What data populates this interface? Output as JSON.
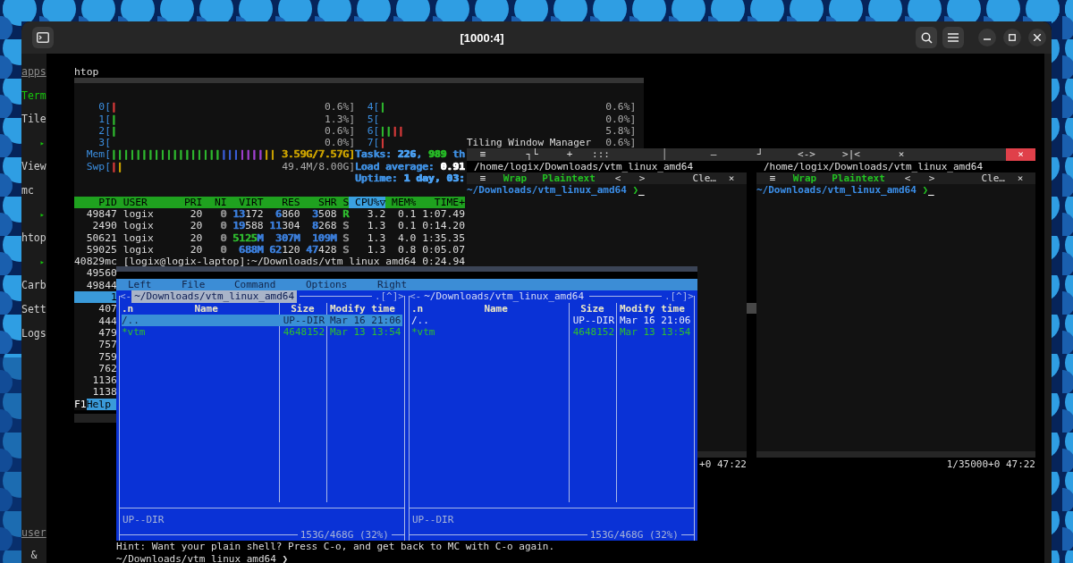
{
  "window": {
    "title": "[1000:4]"
  },
  "sidebar": {
    "items": [
      {
        "label": "apps",
        "kind": "heading",
        "selected": false
      },
      {
        "label": "Term",
        "kind": "app",
        "selected": true
      },
      {
        "label": "Tile",
        "kind": "app",
        "selected": false
      },
      {
        "label": "▸",
        "kind": "arrow"
      },
      {
        "label": "View",
        "kind": "app",
        "selected": false
      },
      {
        "label": "mc",
        "kind": "app",
        "selected": false
      },
      {
        "label": "▸",
        "kind": "arrow"
      },
      {
        "label": "htop",
        "kind": "app",
        "selected": false
      },
      {
        "label": "▸",
        "kind": "arrow"
      },
      {
        "label": "Carb",
        "kind": "app",
        "selected": false
      },
      {
        "label": "Sett",
        "kind": "app",
        "selected": false
      },
      {
        "label": "Logs",
        "kind": "app",
        "selected": false
      }
    ],
    "footer": [
      {
        "label": "user",
        "kind": "heading"
      },
      {
        "label": "&",
        "kind": "app"
      }
    ]
  },
  "htop": {
    "title": "htop",
    "meters_left": [
      {
        "label": "0[",
        "bar": [
          {
            "text": "|",
            "color": "#d33a3a"
          }
        ],
        "reading": "0.6%]"
      },
      {
        "label": "1[",
        "bar": [
          {
            "text": "|",
            "color": "#2fb82f"
          }
        ],
        "reading": "1.3%]"
      },
      {
        "label": "2[",
        "bar": [
          {
            "text": "|",
            "color": "#2fb82f"
          }
        ],
        "reading": "0.6%]"
      },
      {
        "label": "3[",
        "reading": "0.0%]"
      },
      {
        "label": "Mem[",
        "bar": [
          {
            "text": "||||||||||||||||||",
            "color": "#2fb82f"
          },
          {
            "text": "|||",
            "color": "#3b5fd8"
          },
          {
            "text": "||||",
            "color": "#a040d0"
          },
          {
            "text": "||",
            "color": "#c8a000"
          }
        ],
        "reading": {
          "text": "3.59G/7.57G]",
          "color": "#c8a000"
        }
      },
      {
        "label": "Swp[",
        "bar": [
          {
            "text": "|",
            "color": "#d33a3a"
          },
          {
            "text": "|",
            "color": "#c8a000"
          }
        ],
        "reading": "49.4M/8.00G]"
      }
    ],
    "meters_right": [
      {
        "label": "4[",
        "bar": [
          {
            "text": "|",
            "color": "#2fb82f"
          }
        ],
        "reading": "0.6%]"
      },
      {
        "label": "5[",
        "reading": "0.0%]"
      },
      {
        "label": "6[",
        "bar": [
          {
            "text": "||",
            "color": "#2fb82f"
          },
          {
            "text": "||",
            "color": "#d33a3a"
          }
        ],
        "reading": "5.8%]"
      },
      {
        "label": "7[",
        "bar": [
          {
            "text": "|",
            "color": "#d33a3a"
          }
        ],
        "reading": "0.6%]"
      }
    ],
    "summary": [
      [
        {
          "text": "Tasks: ",
          "color": "#3f8fe0"
        },
        {
          "text": "226",
          "color": "#4a9ff0",
          "bold": true
        },
        {
          "text": ", ",
          "color": "#3f8fe0"
        },
        {
          "text": "989",
          "color": "#26b626",
          "bold": true
        },
        {
          "text": " th",
          "color": "#3f8fe0"
        }
      ],
      [
        {
          "text": "Load average: ",
          "color": "#3f8fe0"
        },
        {
          "text": "0.91",
          "color": "#ffffff",
          "bold": true
        }
      ],
      [
        {
          "text": "Uptime: ",
          "color": "#3f8fe0"
        },
        {
          "text": "1 day, 03:",
          "color": "#4a9ff0",
          "bold": true
        }
      ]
    ],
    "columns": [
      {
        "label": "PID",
        "selected": false
      },
      {
        "label": "USER",
        "selected": false
      },
      {
        "label": "PRI",
        "selected": false
      },
      {
        "label": "NI",
        "selected": false
      },
      {
        "label": "VIRT",
        "selected": false
      },
      {
        "label": "RES",
        "selected": false
      },
      {
        "label": "SHR",
        "selected": false
      },
      {
        "label": "S",
        "selected": false
      },
      {
        "label": "CPU%▽",
        "selected": true
      },
      {
        "label": "MEM%",
        "selected": false
      },
      {
        "label": "TIME+",
        "selected": false
      }
    ],
    "processes": [
      {
        "kind": "full",
        "selected": false,
        "cells": [
          "49847",
          "logix",
          "20",
          [
            {
              "text": "0",
              "color": "#888888"
            }
          ],
          [
            {
              "text": "13",
              "color": "#3b7dd8"
            },
            {
              "text": "172"
            }
          ],
          [
            {
              "text": "6",
              "color": "#3b7dd8"
            },
            {
              "text": "860"
            }
          ],
          [
            {
              "text": "3",
              "color": "#3b7dd8"
            },
            {
              "text": "508"
            }
          ],
          [
            {
              "text": "R",
              "color": "#2fb82f"
            }
          ],
          "3.2",
          "0.1",
          "1:07.49"
        ]
      },
      {
        "kind": "full",
        "selected": false,
        "cells": [
          "2490",
          "logix",
          "20",
          [
            {
              "text": "0",
              "color": "#888888"
            }
          ],
          [
            {
              "text": "19",
              "color": "#3b7dd8"
            },
            {
              "text": "588"
            }
          ],
          [
            {
              "text": "11",
              "color": "#3b7dd8"
            },
            {
              "text": "304"
            }
          ],
          [
            {
              "text": "8",
              "color": "#3b7dd8"
            },
            {
              "text": "268"
            }
          ],
          [
            {
              "text": "S",
              "color": "#888888"
            }
          ],
          "1.3",
          "0.1",
          "0:14.20"
        ]
      },
      {
        "kind": "full",
        "selected": false,
        "cells": [
          "50621",
          "logix",
          "20",
          [
            {
              "text": "0",
              "color": "#888888"
            }
          ],
          [
            {
              "text": "5125",
              "color": "#2fb82f"
            },
            {
              "text": "M",
              "color": "#3b7dd8"
            }
          ],
          [
            {
              "text": "307M",
              "color": "#3b7dd8"
            }
          ],
          [
            {
              "text": "109M",
              "color": "#3b7dd8"
            }
          ],
          [
            {
              "text": "S",
              "color": "#888888"
            }
          ],
          "1.3",
          "4.0",
          "1:35.35"
        ]
      },
      {
        "kind": "full",
        "selected": false,
        "cells": [
          "59025",
          "logix",
          "20",
          [
            {
              "text": "0",
              "color": "#888888"
            }
          ],
          [
            {
              "text": "688M",
              "color": "#3b7dd8"
            }
          ],
          [
            {
              "text": "62",
              "color": "#3b7dd8"
            },
            {
              "text": "120"
            }
          ],
          [
            {
              "text": "47",
              "color": "#3b7dd8"
            },
            {
              "text": "428"
            }
          ],
          [
            {
              "text": "S",
              "color": "#888888"
            }
          ],
          "1.3",
          "0.8",
          "0:05.07"
        ]
      },
      {
        "kind": "line",
        "selected": false,
        "text": "40829mc [logix@logix-laptop]:~/Downloads/vtm_linux_amd64 0:24.94"
      },
      {
        "kind": "pid",
        "selected": false,
        "pid": "49560"
      },
      {
        "kind": "pid",
        "selected": false,
        "pid": "49844"
      },
      {
        "kind": "pid",
        "selected": true,
        "pid": "1"
      },
      {
        "kind": "pid",
        "selected": false,
        "pid": "407"
      },
      {
        "kind": "pid",
        "selected": false,
        "pid": "444"
      },
      {
        "kind": "pid",
        "selected": false,
        "pid": "479"
      },
      {
        "kind": "pid",
        "selected": false,
        "pid": "757"
      },
      {
        "kind": "pid",
        "selected": false,
        "pid": "759"
      },
      {
        "kind": "pid",
        "selected": false,
        "pid": "762"
      },
      {
        "kind": "pid",
        "selected": false,
        "pid": "1136"
      },
      {
        "kind": "pid",
        "selected": false,
        "pid": "1138"
      }
    ],
    "footer": [
      {
        "key": "F1",
        "label": "Help"
      }
    ]
  },
  "tiling": {
    "title": "Tiling Window Manager",
    "toolbar": [
      {
        "label": "≡",
        "kind": "button"
      },
      {
        "label": "┐└",
        "kind": "button"
      },
      {
        "label": "+",
        "kind": "button"
      },
      {
        "label": ":::",
        "kind": "button"
      },
      {
        "label": "│",
        "kind": "divider"
      },
      {
        "label": "—",
        "kind": "button"
      },
      {
        "label": "┘",
        "kind": "button"
      },
      {
        "label": "<->",
        "kind": "button"
      },
      {
        "label": ">|<",
        "kind": "button"
      },
      {
        "label": "×",
        "kind": "button"
      },
      {
        "label": "×",
        "kind": "close"
      }
    ],
    "panes": [
      {
        "path": "/home/logix/Downloads/vtm_linux_amd64",
        "tools": [
          {
            "label": "≡",
            "on": false
          },
          {
            "label": "Wrap",
            "on": true
          },
          {
            "label": "Plaintext",
            "on": true
          },
          {
            "label": "<",
            "on": false
          },
          {
            "label": ">",
            "on": false
          },
          {
            "label": "Cle…",
            "on": false
          },
          {
            "label": "×",
            "on": false
          }
        ],
        "prompt": {
          "path": "~/Downloads/vtm_linux_amd64",
          "symbol": " ❯",
          "cursor": "_"
        },
        "status": "+0 47:22"
      },
      {
        "path": "/home/logix/Downloads/vtm_linux_amd64",
        "tools": [
          {
            "label": "≡",
            "on": false
          },
          {
            "label": "Wrap",
            "on": true
          },
          {
            "label": "Plaintext",
            "on": true
          },
          {
            "label": "<",
            "on": false
          },
          {
            "label": ">",
            "on": false
          },
          {
            "label": "Cle…",
            "on": false
          },
          {
            "label": "×",
            "on": false
          }
        ],
        "prompt": {
          "path": "~/Downloads/vtm_linux_amd64",
          "symbol": " ❯",
          "cursor": "_"
        },
        "status": "1/35000+0 47:22"
      }
    ]
  },
  "mc": {
    "menu": [
      "Left",
      "File",
      "Command",
      "Options",
      "Right"
    ],
    "panels": [
      {
        "selected": true,
        "left_mark": "<-",
        "title": "~/Downloads/vtm_linux_amd64",
        "right_mark": ".[^]>",
        "columns": [
          ".n",
          "Name",
          "Size",
          "Modify time"
        ],
        "files": [
          {
            "name": "/..",
            "size": "UP--DIR",
            "modified": "Mar 16 21:06",
            "kind": "dir",
            "selected": true
          },
          {
            "name": "*vtm",
            "size": "4648152",
            "modified": "Mar 13 13:54",
            "kind": "exec",
            "selected": false
          }
        ],
        "info": "UP--DIR",
        "disk": "153G/468G (32%)"
      },
      {
        "selected": false,
        "left_mark": "<-",
        "title": "~/Downloads/vtm_linux_amd64",
        "right_mark": ".[^]>",
        "columns": [
          ".n",
          "Name",
          "Size",
          "Modify time"
        ],
        "files": [
          {
            "name": "/..",
            "size": "UP--DIR",
            "modified": "Mar 16 21:06",
            "kind": "dir",
            "selected": false
          },
          {
            "name": "*vtm",
            "size": "4648152",
            "modified": "Mar 13 13:54",
            "kind": "exec",
            "selected": false
          }
        ],
        "info": "UP--DIR",
        "disk": "153G/468G (32%)"
      }
    ],
    "hint": "Hint: Want your plain shell? Press C-o, and get back to MC with C-o again.",
    "prompt": {
      "path": "~/Downloads/vtm_linux_amd64",
      "symbol": " ❯"
    }
  }
}
